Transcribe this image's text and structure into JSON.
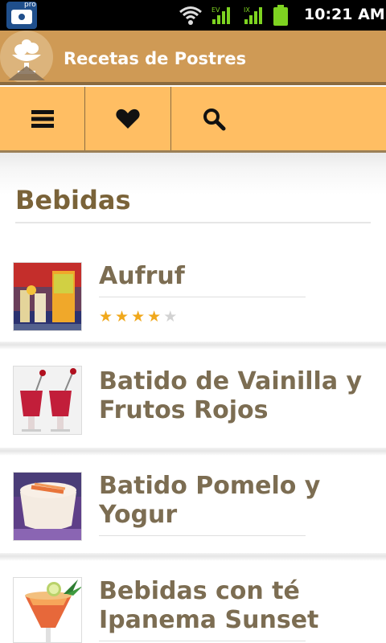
{
  "status_bar": {
    "time": "10:21 AM",
    "app_badge": "pro",
    "signal_labels": [
      "EV",
      "IX"
    ]
  },
  "header": {
    "title": "Recetas de Postres"
  },
  "toolbar": {
    "buttons": [
      {
        "icon": "menu-icon"
      },
      {
        "icon": "heart-icon"
      },
      {
        "icon": "search-icon"
      }
    ]
  },
  "section": {
    "title": "Bebidas"
  },
  "recipes": [
    {
      "name": "Aufruf",
      "rating": 4,
      "max_rating": 5,
      "image": "cocktail-glasses-photo"
    },
    {
      "name": "Batido de Vainilla y Frutos Rojos",
      "image": "red-smoothies-photo"
    },
    {
      "name": "Batido Pomelo y Yogur",
      "image": "grapefruit-yogurt-shake-photo"
    },
    {
      "name": "Bebidas con té Ipanema Sunset",
      "image": "ipanema-sunset-drink-photo"
    }
  ],
  "colors": {
    "status_bar": "#000000",
    "title_bar": "#cf9a55",
    "toolbar": "#ffbe63",
    "section_title": "#7a6339",
    "item_title": "#7c6d52",
    "star_filled": "#f0a81c",
    "star_empty": "#d2d2d2"
  }
}
